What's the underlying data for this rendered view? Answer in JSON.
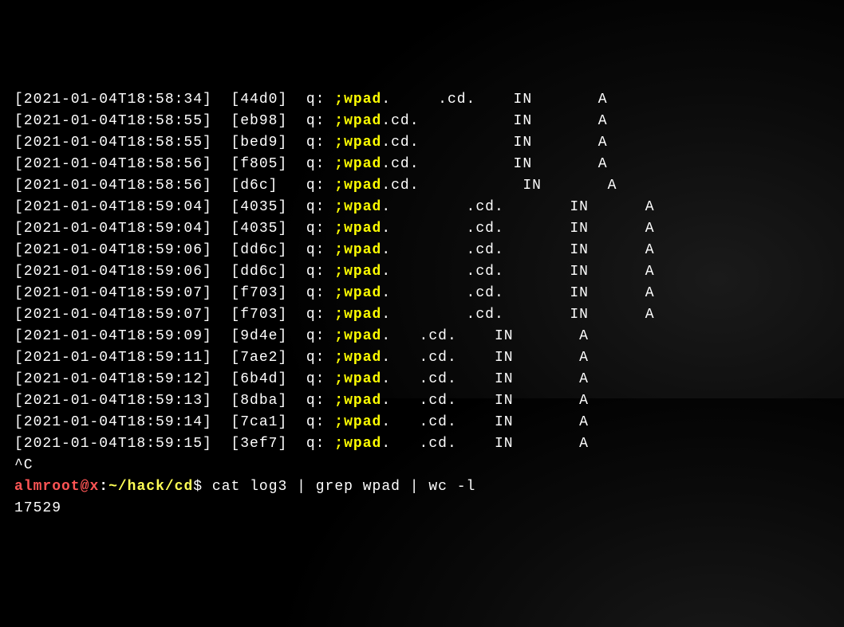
{
  "log_lines": [
    {
      "ts": "[2021-01-04T18:58:34]",
      "hash": "[44d0]",
      "q": "q:",
      "semi": ";",
      "wpad": "wpad",
      "after_wpad": ".     .cd.    IN       A"
    },
    {
      "ts": "[2021-01-04T18:58:55]",
      "hash": "[eb98]",
      "q": "q:",
      "semi": ";",
      "wpad": "wpad",
      "after_wpad": ".cd.          IN       A"
    },
    {
      "ts": "[2021-01-04T18:58:55]",
      "hash": "[bed9]",
      "q": "q:",
      "semi": ";",
      "wpad": "wpad",
      "after_wpad": ".cd.          IN       A"
    },
    {
      "ts": "[2021-01-04T18:58:56]",
      "hash": "[f805]",
      "q": "q:",
      "semi": ";",
      "wpad": "wpad",
      "after_wpad": ".cd.          IN       A"
    },
    {
      "ts": "[2021-01-04T18:58:56]",
      "hash": "[d6c]",
      "q": " q:",
      "semi": ";",
      "wpad": "wpad",
      "after_wpad": ".cd.           IN       A"
    },
    {
      "ts": "[2021-01-04T18:59:04]",
      "hash": "[4035]",
      "q": "q:",
      "semi": ";",
      "wpad": "wpad",
      "after_wpad": ".        .cd.       IN      A"
    },
    {
      "ts": "[2021-01-04T18:59:04]",
      "hash": "[4035]",
      "q": "q:",
      "semi": ";",
      "wpad": "wpad",
      "after_wpad": ".        .cd.       IN      A"
    },
    {
      "ts": "[2021-01-04T18:59:06]",
      "hash": "[dd6c]",
      "q": "q:",
      "semi": ";",
      "wpad": "wpad",
      "after_wpad": ".        .cd.       IN      A"
    },
    {
      "ts": "[2021-01-04T18:59:06]",
      "hash": "[dd6c]",
      "q": "q:",
      "semi": ";",
      "wpad": "wpad",
      "after_wpad": ".        .cd.       IN      A"
    },
    {
      "ts": "[2021-01-04T18:59:07]",
      "hash": "[f703]",
      "q": "q:",
      "semi": ";",
      "wpad": "wpad",
      "after_wpad": ".        .cd.       IN      A"
    },
    {
      "ts": "[2021-01-04T18:59:07]",
      "hash": "[f703]",
      "q": "q:",
      "semi": ";",
      "wpad": "wpad",
      "after_wpad": ".        .cd.       IN      A"
    },
    {
      "ts": "[2021-01-04T18:59:09]",
      "hash": "[9d4e]",
      "q": "q:",
      "semi": ";",
      "wpad": "wpad",
      "after_wpad": ".   .cd.    IN       A"
    },
    {
      "ts": "[2021-01-04T18:59:11]",
      "hash": "[7ae2]",
      "q": "q:",
      "semi": ";",
      "wpad": "wpad",
      "after_wpad": ".   .cd.    IN       A"
    },
    {
      "ts": "[2021-01-04T18:59:12]",
      "hash": "[6b4d]",
      "q": "q:",
      "semi": ";",
      "wpad": "wpad",
      "after_wpad": ".   .cd.    IN       A"
    },
    {
      "ts": "[2021-01-04T18:59:13]",
      "hash": "[8dba]",
      "q": "q:",
      "semi": ";",
      "wpad": "wpad",
      "after_wpad": ".   .cd.    IN       A"
    },
    {
      "ts": "[2021-01-04T18:59:14]",
      "hash": "[7ca1]",
      "q": "q:",
      "semi": ";",
      "wpad": "wpad",
      "after_wpad": ".   .cd.    IN       A"
    },
    {
      "ts": "[2021-01-04T18:59:15]",
      "hash": "[3ef7]",
      "q": "q:",
      "semi": ";",
      "wpad": "wpad",
      "after_wpad": ".   .cd.    IN       A"
    }
  ],
  "ctrl_c": "^C",
  "prompt": {
    "user": "almroot",
    "at": "@",
    "host": "x",
    "colon": ":",
    "path": "~/hack/cd",
    "dollar": "$"
  },
  "command": " cat log3 | grep wpad | wc -l",
  "output": "17529"
}
